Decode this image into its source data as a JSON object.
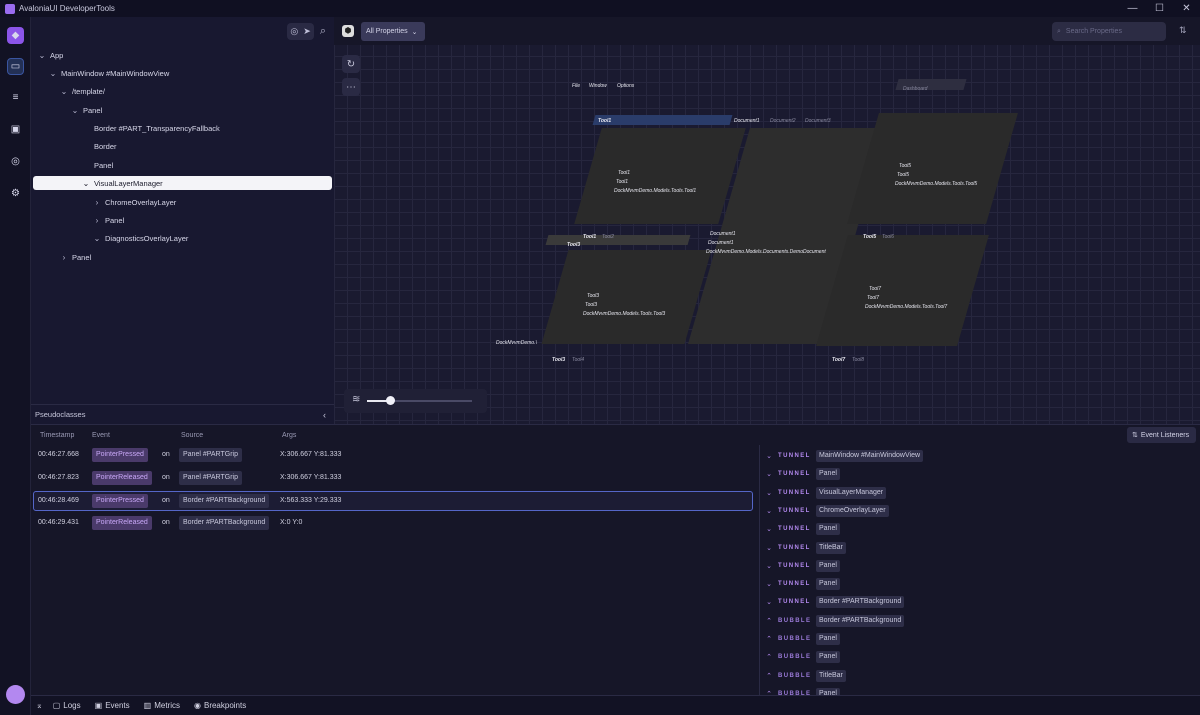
{
  "window": {
    "title": "AvaloniaUI DeveloperTools",
    "minimize": "—",
    "maximize": "☐",
    "close": "✕"
  },
  "tree": {
    "nodes": [
      {
        "label": "App",
        "chev": "⌄"
      },
      {
        "label": "MainWindow #MainWindowView",
        "chev": "⌄"
      },
      {
        "label": "/template/",
        "chev": "⌄"
      },
      {
        "label": "Panel",
        "chev": "⌄"
      },
      {
        "label": "Border #PART_TransparencyFallback",
        "chev": ""
      },
      {
        "label": "Border",
        "chev": ""
      },
      {
        "label": "Panel",
        "chev": ""
      },
      {
        "label": "VisualLayerManager",
        "chev": "⌄"
      },
      {
        "label": "ChromeOverlayLayer",
        "chev": "›"
      },
      {
        "label": "Panel",
        "chev": "›"
      },
      {
        "label": "DiagnosticsOverlayLayer",
        "chev": "⌄"
      },
      {
        "label": "Panel",
        "chev": "›"
      }
    ]
  },
  "pseudo": {
    "label": "Pseudoclasses",
    "chev": "‹"
  },
  "properties": {
    "filter": "All Properties",
    "search_placeholder": "Search Properties"
  },
  "zoom": {
    "value": 0.22
  },
  "preview": {
    "menu": [
      "File",
      "Window",
      "Options"
    ],
    "dashboard": "Dashboard",
    "labels": {
      "tool1_tab": "Tool1",
      "doc_tabs": [
        "Document1",
        "Document2",
        "Document3"
      ],
      "tool1": [
        "Tool1",
        "Tool1",
        "DockMvvmDemo.Models.Tools.Tool1"
      ],
      "tool5": [
        "Tool5",
        "Tool5",
        "DockMvvmDemo.Models.Tools.Tool5"
      ],
      "doc1": [
        "Document1",
        "Document1",
        "DockMvvmDemo.Models.Documents.DemoDocument"
      ],
      "tool12": [
        "Tool1",
        "Tool2"
      ],
      "tool3tab": "Tool3",
      "tool56": [
        "Tool5",
        "Tool6"
      ],
      "tool3": [
        "Tool3",
        "Tool3",
        "DockMvvmDemo.Models.Tools.Tool3"
      ],
      "tool7": [
        "Tool7",
        "Tool7",
        "DockMvvmDemo.Models.Tools.Tool7"
      ],
      "cut": "DockMvvmDemo.\\",
      "tool34": [
        "Tool3",
        "Tool4"
      ],
      "tool78": [
        "Tool7",
        "Tool8"
      ]
    }
  },
  "events": {
    "headers": {
      "timestamp": "Timestamp",
      "event": "Event",
      "source": "Source",
      "args": "Args"
    },
    "rows": [
      {
        "time": "00:46:27.668",
        "event": "PointerPressed",
        "on": "on",
        "source": "Panel #PARTGrip",
        "args": "X:306.667 Y:81.333"
      },
      {
        "time": "00:46:27.823",
        "event": "PointerReleased",
        "on": "on",
        "source": "Panel #PARTGrip",
        "args": "X:306.667 Y:81.333"
      },
      {
        "time": "00:46:28.469",
        "event": "PointerPressed",
        "on": "on",
        "source": "Border #PARTBackground",
        "args": "X:563.333 Y:29.333"
      },
      {
        "time": "00:46:29.431",
        "event": "PointerReleased",
        "on": "on",
        "source": "Border #PARTBackground",
        "args": "X:0 Y:0"
      }
    ],
    "listeners_button": "Event Listeners",
    "route": [
      {
        "phase": "TUNNEL",
        "element": "MainWindow #MainWindowView"
      },
      {
        "phase": "TUNNEL",
        "element": "Panel"
      },
      {
        "phase": "TUNNEL",
        "element": "VisualLayerManager"
      },
      {
        "phase": "TUNNEL",
        "element": "ChromeOverlayLayer"
      },
      {
        "phase": "TUNNEL",
        "element": "Panel"
      },
      {
        "phase": "TUNNEL",
        "element": "TitleBar"
      },
      {
        "phase": "TUNNEL",
        "element": "Panel"
      },
      {
        "phase": "TUNNEL",
        "element": "Panel"
      },
      {
        "phase": "TUNNEL",
        "element": "Border #PARTBackground"
      },
      {
        "phase": "BUBBLE",
        "element": "Border #PARTBackground"
      },
      {
        "phase": "BUBBLE",
        "element": "Panel"
      },
      {
        "phase": "BUBBLE",
        "element": "Panel"
      },
      {
        "phase": "BUBBLE",
        "element": "TitleBar"
      },
      {
        "phase": "BUBBLE",
        "element": "Panel"
      }
    ]
  },
  "statusbar": {
    "logs": "Logs",
    "events": "Events",
    "metrics": "Metrics",
    "breakpoints": "Breakpoints"
  }
}
